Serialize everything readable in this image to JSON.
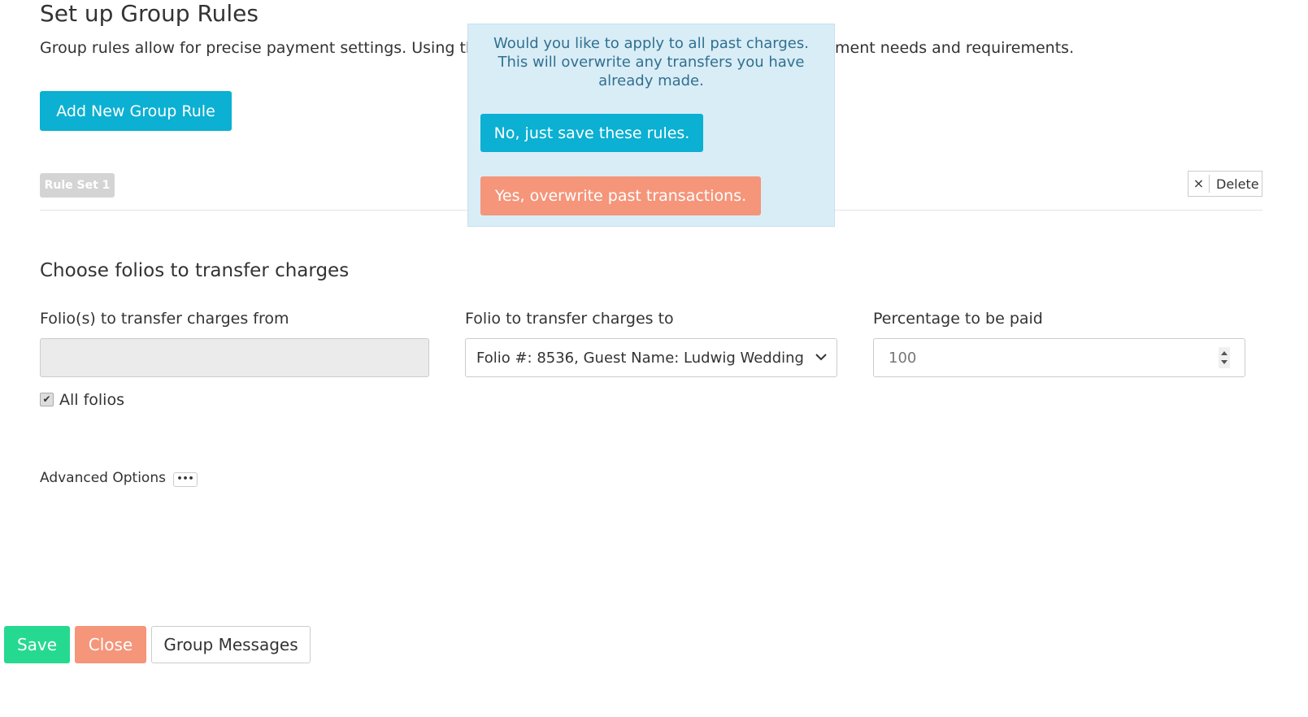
{
  "page": {
    "title": "Set up Group Rules",
    "description_left": "Group rules allow for precise payment settings. Using th",
    "description_right": "ment needs and requirements.",
    "add_rule_label": "Add New Group Rule"
  },
  "rule_set": {
    "badge": "Rule Set 1",
    "delete_icon": "×",
    "delete_label": "Delete"
  },
  "popover": {
    "message": "Would you like to apply to all past charges. This will overwrite any transfers you have already made.",
    "no_label": "No, just save these rules.",
    "yes_label": "Yes, overwrite past transactions."
  },
  "folios": {
    "heading": "Choose folios to transfer charges",
    "from_label": "Folio(s) to transfer charges from",
    "from_value": "",
    "to_label": "Folio to transfer charges to",
    "to_value": "Folio #: 8536, Guest Name: Ludwig Wedding",
    "percent_label": "Percentage to be paid",
    "percent_value": "100",
    "all_folios_label": "All folios",
    "all_folios_checked": true
  },
  "advanced": {
    "label": "Advanced Options",
    "button": "•••"
  },
  "footer": {
    "save": "Save",
    "close": "Close",
    "group_messages": "Group Messages"
  },
  "colors": {
    "info": "#0bb0d2",
    "warning": "#f5957a",
    "success": "#26d990",
    "popover_bg": "#d9edf7"
  }
}
